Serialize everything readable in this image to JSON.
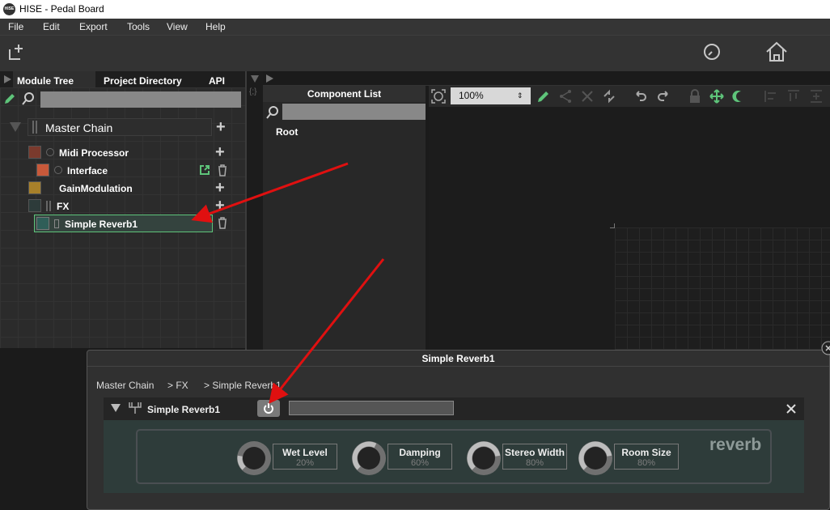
{
  "app": {
    "title": "HISE - Pedal Board",
    "logo": "HISE"
  },
  "menu": [
    "File",
    "Edit",
    "Export",
    "Tools",
    "View",
    "Help"
  ],
  "left_tabs": [
    "Module Tree",
    "Project Directory",
    "API"
  ],
  "tree": {
    "root": "Master Chain",
    "items": [
      {
        "label": "Midi Processor",
        "color": "#7a3a2d"
      },
      {
        "label": "Interface",
        "color": "#c8593a"
      },
      {
        "label": "GainModulation",
        "color": "#a8802a"
      },
      {
        "label": "FX",
        "color": "#2d3b3a"
      },
      {
        "label": "Simple Reverb1",
        "color": "#2f5e58"
      }
    ]
  },
  "component_list": {
    "header": "Component List",
    "root": "Root"
  },
  "canvas": {
    "zoom": "100%"
  },
  "popup": {
    "title": "Simple Reverb1",
    "breadcrumb": [
      "Master Chain",
      "> FX",
      "> Simple Reverb1"
    ],
    "module_name": "Simple Reverb1",
    "watermark": "reverb",
    "knobs": [
      {
        "name": "Wet Level",
        "value": "20%",
        "level": 0.2
      },
      {
        "name": "Damping",
        "value": "60%",
        "level": 0.6
      },
      {
        "name": "Stereo Width",
        "value": "80%",
        "level": 0.8
      },
      {
        "name": "Room Size",
        "value": "80%",
        "level": 0.8
      }
    ]
  },
  "colors": {
    "accent_green": "#5ec47a",
    "annotation_arrow": "#e01010"
  }
}
